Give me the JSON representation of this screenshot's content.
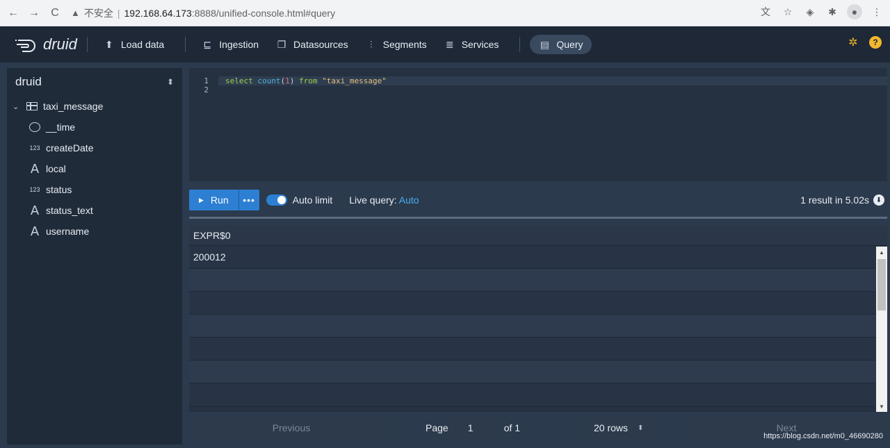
{
  "browser": {
    "insecure_label": "不安全",
    "url_host": "192.168.64.173",
    "url_rest": ":8888/unified-console.html#query"
  },
  "header": {
    "brand": "druid",
    "load_data": "Load data",
    "nav": [
      {
        "label": "Ingestion",
        "icon": "ingestion-icon"
      },
      {
        "label": "Datasources",
        "icon": "datasources-icon"
      },
      {
        "label": "Segments",
        "icon": "segments-icon"
      },
      {
        "label": "Services",
        "icon": "services-icon"
      }
    ],
    "active": "Query"
  },
  "sidebar": {
    "schema": "druid",
    "table": "taxi_message",
    "columns": [
      {
        "name": "__time",
        "type": "time"
      },
      {
        "name": "createDate",
        "type": "number",
        "badge": "123"
      },
      {
        "name": "local",
        "type": "string",
        "badge": "A"
      },
      {
        "name": "status",
        "type": "number",
        "badge": "123"
      },
      {
        "name": "status_text",
        "type": "string",
        "badge": "A"
      },
      {
        "name": "username",
        "type": "string",
        "badge": "A"
      }
    ]
  },
  "editor": {
    "line_numbers": [
      "1",
      "2"
    ],
    "kw_select": "select",
    "fn_count": "count",
    "paren_open": "(",
    "arg": "1",
    "paren_close": ")",
    "kw_from": "from",
    "table_literal": "\"taxi_message\""
  },
  "runbar": {
    "run_label": "Run",
    "more_label": "•••",
    "auto_limit_label": "Auto limit",
    "live_query_label": "Live query:",
    "live_query_value": "Auto",
    "result_summary": "1 result in 5.02s"
  },
  "results": {
    "columns": [
      "EXPR$0"
    ],
    "rows": [
      [
        "200012"
      ]
    ]
  },
  "pager": {
    "previous": "Previous",
    "page_label": "Page",
    "page_value": "1",
    "of_label": "of 1",
    "rows_per_page": "20 rows",
    "next": "Next"
  },
  "watermark": "https://blog.csdn.net/m0_46690280",
  "colors": {
    "accent": "#2d7fd3",
    "header_bg": "#1e2836",
    "panel_bg": "#202b3a",
    "settings_icon": "#f3b72d"
  }
}
